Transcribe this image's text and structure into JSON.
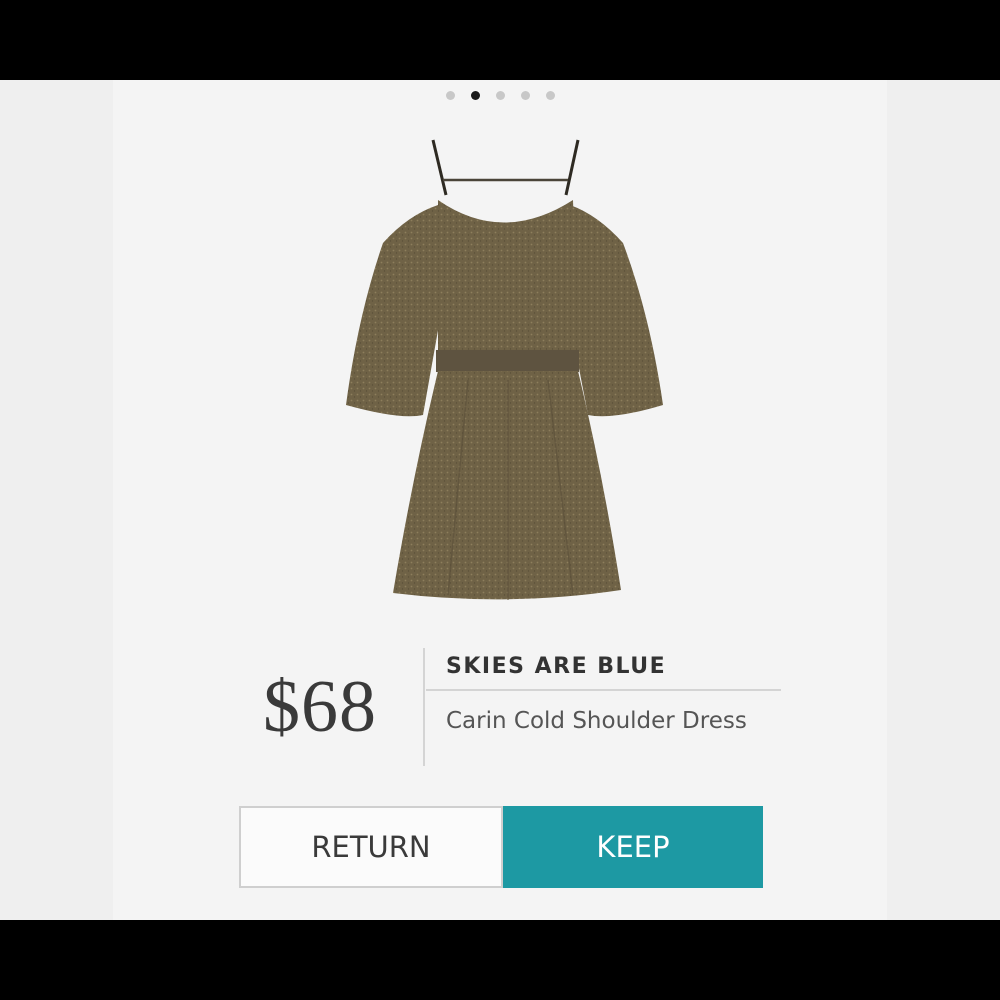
{
  "carousel": {
    "total_pages": 5,
    "active_index": 1
  },
  "product": {
    "image_name": "cold-shoulder-dress-image",
    "price": "$68",
    "brand": "SKIES ARE BLUE",
    "name": "Carin Cold Shoulder Dress"
  },
  "actions": {
    "return_label": "RETURN",
    "keep_label": "KEEP"
  },
  "colors": {
    "accent": "#1d99a3",
    "dress": "#6f6246"
  }
}
